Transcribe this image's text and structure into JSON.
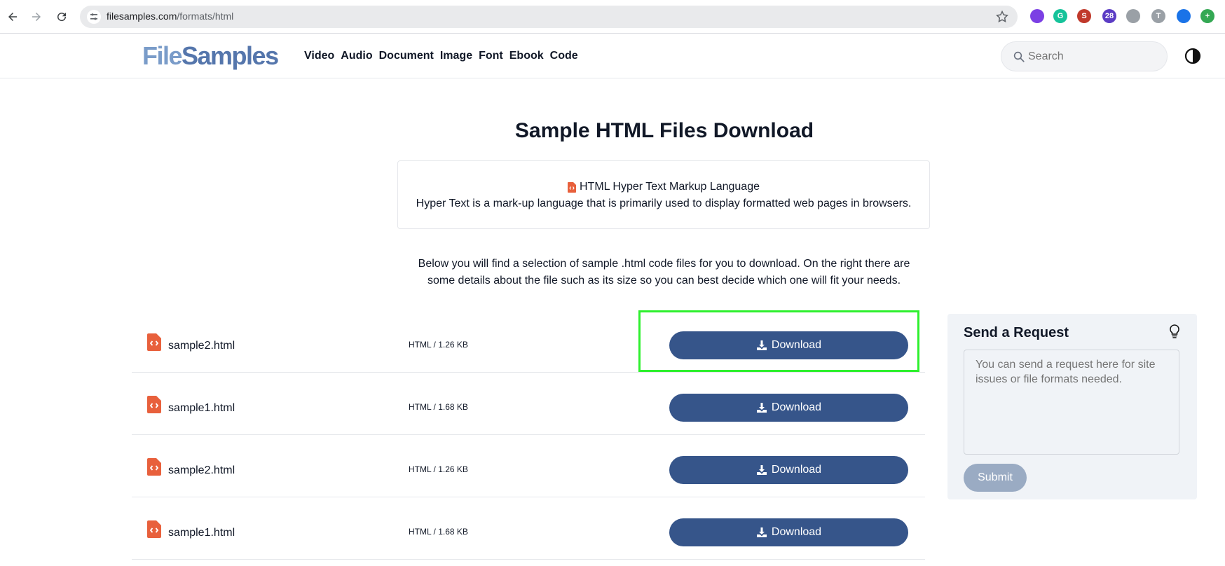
{
  "browser": {
    "url_host": "filesamples.com",
    "url_path": "/formats/html",
    "extensions": [
      {
        "name": "colorful-ring-extension-icon",
        "color": "#7b3fe4",
        "text": ""
      },
      {
        "name": "grammarly-extension-icon",
        "color": "#15c39a",
        "text": "G"
      },
      {
        "name": "red-s-extension-icon",
        "color": "#c0392b",
        "text": "S"
      },
      {
        "name": "cap-extension-icon",
        "color": "#5b3cc4",
        "text": "28"
      },
      {
        "name": "shield-extension-icon",
        "color": "#9aa0a6",
        "text": ""
      },
      {
        "name": "t-extension-icon",
        "color": "#9aa0a6",
        "text": "T"
      },
      {
        "name": "tag-extension-icon",
        "color": "#1a73e8",
        "text": ""
      },
      {
        "name": "plus-extension-icon",
        "color": "#34a853",
        "text": "+"
      }
    ]
  },
  "header": {
    "logo_part1": "File",
    "logo_part2": "Samples",
    "nav": [
      "Video",
      "Audio",
      "Document",
      "Image",
      "Font",
      "Ebook",
      "Code"
    ],
    "search_placeholder": "Search"
  },
  "main": {
    "title": "Sample HTML Files Download",
    "format_name": "HTML Hyper Text Markup Language",
    "format_desc": "Hyper Text is a mark-up language that is primarily used to display formatted web pages in browsers.",
    "intro": "Below you will find a selection of sample .html code files for you to download. On the right there are some details about the file such as its size so you can best decide which one will fit your needs.",
    "download_label": "Download",
    "files": [
      {
        "name": "sample2.html",
        "meta": "HTML / 1.26 KB"
      },
      {
        "name": "sample1.html",
        "meta": "HTML / 1.68 KB"
      },
      {
        "name": "sample2.html",
        "meta": "HTML / 1.26 KB"
      },
      {
        "name": "sample1.html",
        "meta": "HTML / 1.68 KB"
      }
    ]
  },
  "request": {
    "title": "Send a Request",
    "placeholder": "You can send a request here for site issues or file formats needed.",
    "submit_label": "Submit"
  },
  "colors": {
    "button": "#36558a",
    "highlight": "#2ef02e",
    "file_icon": "#e8603c"
  }
}
